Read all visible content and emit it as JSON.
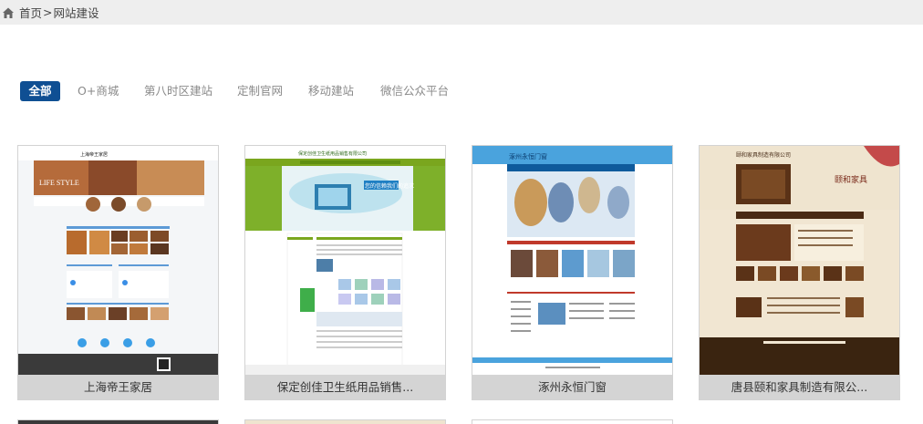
{
  "breadcrumb": {
    "home_icon": "home-icon",
    "home": "首页",
    "separator": ">",
    "current": "网站建设"
  },
  "tabs": [
    {
      "label": "全部",
      "active": true
    },
    {
      "label": "O+商城",
      "active": false
    },
    {
      "label": "第八时区建站",
      "active": false
    },
    {
      "label": "定制官网",
      "active": false
    },
    {
      "label": "移动建站",
      "active": false
    },
    {
      "label": "微信公众平台",
      "active": false
    }
  ],
  "cases": [
    {
      "title": "上海帝王家居",
      "thumb_text": "上海帝王家居",
      "banner_text": "LIFE STYLE"
    },
    {
      "title": "保定创佳卫生纸用品销售...",
      "thumb_text": "保定创佳卫生纸用品销售有限公司",
      "banner_text": "您的信赖我们的追求"
    },
    {
      "title": "涿州永恒门窗",
      "thumb_text": "涿州永恒门窗"
    },
    {
      "title": "唐县颐和家具制造有限公...",
      "thumb_text": "颐和家具制造有限公司",
      "banner_text": "颐和家具"
    }
  ],
  "colors": {
    "tab_active": "#0f4f93",
    "topbar_bg": "#eeeeee",
    "caption_bg": "#d4d4d4"
  }
}
